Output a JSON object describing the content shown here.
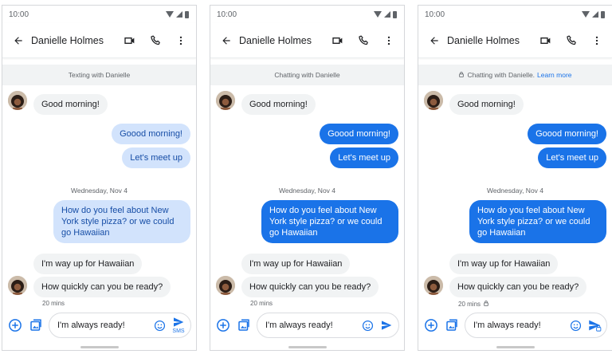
{
  "colors": {
    "accent": "#1a73e8",
    "bubble_incoming": "#f1f3f4",
    "bubble_outgoing_sms": "#d2e3fc",
    "bubble_outgoing_chat": "#1a73e8",
    "banner_bg": "#f1f3f4"
  },
  "screens": [
    {
      "variant": "sms",
      "status": {
        "time": "10:00",
        "icons": [
          "wifi-icon",
          "signal-icon",
          "battery-icon"
        ]
      },
      "header": {
        "title": "Danielle Holmes",
        "icons": [
          "back-arrow-icon",
          "video-call-icon",
          "phone-icon",
          "more-vert-icon"
        ]
      },
      "banner": {
        "text": "Texting with Danielle",
        "link": ""
      },
      "messages": {
        "m1": "Good morning!",
        "m2": "Goood morning!",
        "m3": "Let's meet up",
        "date": "Wednesday, Nov 4",
        "m4": "How do you feel about New York style pizza? or we could go Hawaiian",
        "m5": "I'm way up for Hawaiian",
        "m6": "How quickly can you be ready?",
        "time": "20 mins"
      },
      "compose": {
        "text": "I'm always ready!",
        "send_label": "SMS",
        "icons": [
          "add-icon",
          "gallery-icon",
          "emoji-icon",
          "send-icon"
        ]
      }
    },
    {
      "variant": "chat",
      "status": {
        "time": "10:00",
        "icons": [
          "wifi-icon",
          "signal-icon",
          "battery-icon"
        ]
      },
      "header": {
        "title": "Danielle Holmes",
        "icons": [
          "back-arrow-icon",
          "video-call-icon",
          "phone-icon",
          "more-vert-icon"
        ]
      },
      "banner": {
        "text": "Chatting with Danielle",
        "link": ""
      },
      "messages": {
        "m1": "Good morning!",
        "m2": "Goood morning!",
        "m3": "Let's meet up",
        "date": "Wednesday, Nov 4",
        "m4": "How do you feel about New York style pizza? or we could go Hawaiian",
        "m5": "I'm way up for Hawaiian",
        "m6": "How quickly can you be ready?",
        "time": "20 mins"
      },
      "compose": {
        "text": "I'm always ready!",
        "send_label": "",
        "icons": [
          "add-icon",
          "gallery-icon",
          "emoji-icon",
          "send-icon"
        ]
      }
    },
    {
      "variant": "chat-encrypted",
      "status": {
        "time": "10:00",
        "icons": [
          "wifi-icon",
          "signal-icon",
          "battery-icon"
        ]
      },
      "header": {
        "title": "Danielle Holmes",
        "icons": [
          "back-arrow-icon",
          "video-call-icon",
          "phone-icon",
          "more-vert-icon"
        ]
      },
      "banner": {
        "text": "Chatting with Danielle.",
        "link": "Learn more"
      },
      "messages": {
        "m1": "Good morning!",
        "m2": "Goood morning!",
        "m3": "Let's meet up",
        "date": "Wednesday, Nov 4",
        "m4": "How do you feel about New York style pizza? or we could go Hawaiian",
        "m5": "I'm way up for Hawaiian",
        "m6": "How quickly can you be ready?",
        "time": "20 mins"
      },
      "compose": {
        "text": "I'm always ready!",
        "send_label": "",
        "icons": [
          "add-icon",
          "gallery-icon",
          "emoji-icon",
          "send-icon",
          "lock-icon"
        ]
      }
    }
  ]
}
